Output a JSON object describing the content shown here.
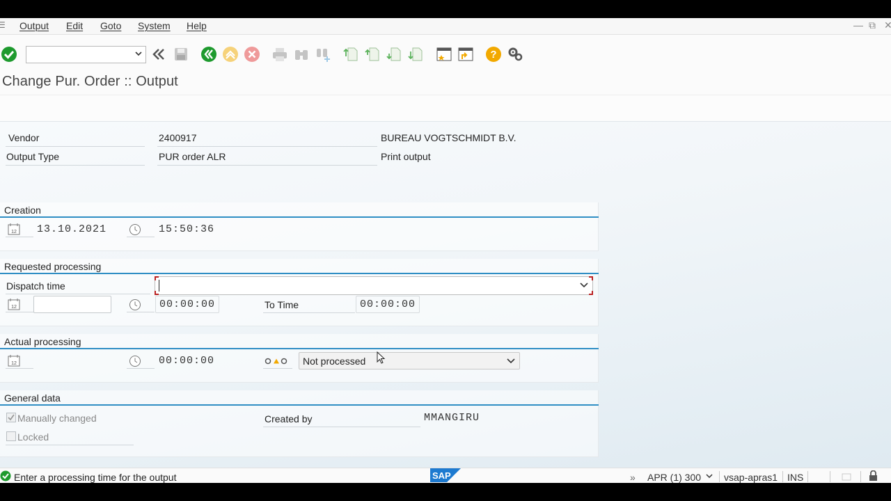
{
  "menu": {
    "items": [
      "Output",
      "Edit",
      "Goto",
      "System",
      "Help"
    ]
  },
  "toolbar": {
    "command_field_value": "",
    "icons": [
      "enter-check",
      "command-dropdown",
      "back-double",
      "save",
      "back",
      "exit",
      "cancel",
      "print",
      "find",
      "find-next",
      "first-page",
      "previous-page",
      "next-page",
      "last-page",
      "create-session",
      "shortcut",
      "help",
      "customize-layout"
    ]
  },
  "page": {
    "title": "Change Pur. Order :: Output"
  },
  "header_fields": {
    "vendor_label": "Vendor",
    "vendor_value": "2400917",
    "vendor_name": "BUREAU VOGTSCHMIDT B.V.",
    "output_type_label": "Output Type",
    "output_type_value": "PUR order ALR",
    "output_type_desc": "Print output"
  },
  "creation": {
    "title": "Creation",
    "date": "13.10.2021",
    "time": "15:50:36"
  },
  "requested_processing": {
    "title": "Requested processing",
    "dispatch_time_label": "Dispatch time",
    "dispatch_time_value": "",
    "date_value": "",
    "time_value": "00:00:00",
    "to_time_label": "To Time",
    "to_time_value": "00:00:00"
  },
  "actual_processing": {
    "title": "Actual processing",
    "time_value": "00:00:00",
    "status_value": "Not processed"
  },
  "general_data": {
    "title": "General data",
    "manually_changed_label": "Manually changed",
    "manually_changed_checked": true,
    "locked_label": "Locked",
    "locked_checked": false,
    "created_by_label": "Created by",
    "created_by_value": "MMANGIRU"
  },
  "statusbar": {
    "message": "Enter a processing time for the output",
    "system": "APR (1) 300",
    "server": "vsap-apras1",
    "mode": "INS"
  },
  "colors": {
    "accent_blue": "#2f8ec4",
    "ok_green": "#1e9a2e",
    "help_orange": "#f2a900",
    "cancel_red": "#e57373"
  }
}
